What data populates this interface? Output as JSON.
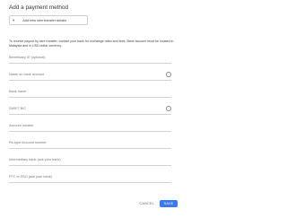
{
  "dialog": {
    "title": "Add a payment method",
    "method_select": {
      "value": "Add new wire transfer details"
    },
    "note": "To receive payout by wire transfer, contact your bank for exchange rates and fees. Bank account must be located in Malaysia and in USD dollar currency.",
    "fields": [
      {
        "label": "Beneficiary ID (optional)",
        "info": false
      },
      {
        "label": "Name on bank account",
        "info": true
      },
      {
        "label": "Bank name",
        "info": false
      },
      {
        "label": "SWIFT BIC",
        "info": true
      },
      {
        "label": "Account number",
        "info": false
      },
      {
        "label": "Re-type Account number",
        "info": false
      },
      {
        "label": "Intermediary bank (ask your bank)",
        "info": false
      },
      {
        "label": "FFC or FBO (ask your bank)",
        "info": false
      }
    ],
    "actions": {
      "cancel": "CANCEL",
      "save": "SAVE"
    }
  }
}
